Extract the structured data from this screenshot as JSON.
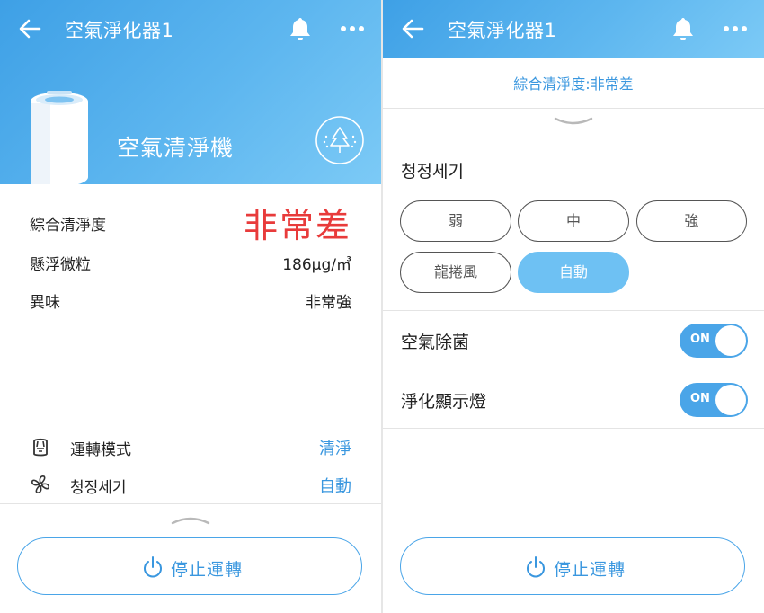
{
  "colors": {
    "accent": "#3a97df",
    "header": "#4aa8ea",
    "alert_red": "#e83b3b",
    "selected_pill": "#6ec1f3"
  },
  "left": {
    "appbar": {
      "title": "空氣淨化器1",
      "icons": [
        "back-arrow-icon",
        "bell-icon",
        "more-icon"
      ]
    },
    "hero": {
      "device_name": "空氣清淨機",
      "mode_icon": "tree-icon"
    },
    "status": [
      {
        "label": "綜合清淨度",
        "value": "非常差"
      },
      {
        "label": "懸浮微粒",
        "value": "186µg/㎥"
      },
      {
        "label": "異味",
        "value": "非常強"
      }
    ],
    "settings": [
      {
        "icon": "air-purifier-icon",
        "label": "運轉模式",
        "value": "清淨"
      },
      {
        "icon": "fan-icon",
        "label": "청정세기",
        "value": "自動"
      }
    ],
    "stop_button": "停止運轉"
  },
  "right": {
    "appbar": {
      "title": "空氣淨化器1",
      "icons": [
        "back-arrow-icon",
        "bell-icon",
        "more-icon"
      ]
    },
    "summary": "綜合清淨度:非常差",
    "strength": {
      "title": "청정세기",
      "options": [
        {
          "label": "弱",
          "selected": false
        },
        {
          "label": "中",
          "selected": false
        },
        {
          "label": "強",
          "selected": false
        },
        {
          "label": "龍捲風",
          "selected": false
        },
        {
          "label": "自動",
          "selected": true
        }
      ]
    },
    "toggles": [
      {
        "label": "空氣除菌",
        "state": "ON"
      },
      {
        "label": "淨化顯示燈",
        "state": "ON"
      }
    ],
    "stop_button": "停止運轉"
  }
}
